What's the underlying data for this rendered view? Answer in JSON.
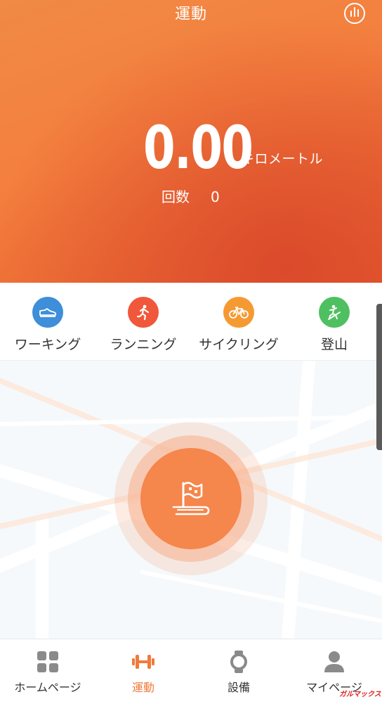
{
  "header": {
    "title": "運動",
    "stats_button": "chart-bars-icon"
  },
  "summary": {
    "distance": "0.00",
    "unit": "キロメートル",
    "count_label": "回数",
    "count_value": "0"
  },
  "sport_tabs": [
    {
      "label": "ワーキング",
      "icon": "shoe-icon",
      "color": "#3e8ed9",
      "selected": true
    },
    {
      "label": "ランニング",
      "icon": "runner-icon",
      "color": "#f0573b",
      "selected": false
    },
    {
      "label": "サイクリング",
      "icon": "bicycle-icon",
      "color": "#f59a32",
      "selected": false
    },
    {
      "label": "登山",
      "icon": "climber-icon",
      "color": "#4fc061",
      "selected": false
    }
  ],
  "start": {
    "icon": "flag-icon"
  },
  "bottom_nav": [
    {
      "label": "ホームページ",
      "icon": "grid-icon",
      "active": false
    },
    {
      "label": "運動",
      "icon": "dumbbell-icon",
      "active": true
    },
    {
      "label": "設備",
      "icon": "watch-icon",
      "active": false
    },
    {
      "label": "マイページ",
      "icon": "person-icon",
      "active": false
    }
  ],
  "colors": {
    "accent": "#f5864c",
    "header_top": "#f08a44",
    "header_bottom": "#db4a2b",
    "nav_active": "#f07a3c",
    "nav_inactive": "#8a8a8a"
  },
  "watermark": "ガルマックス"
}
